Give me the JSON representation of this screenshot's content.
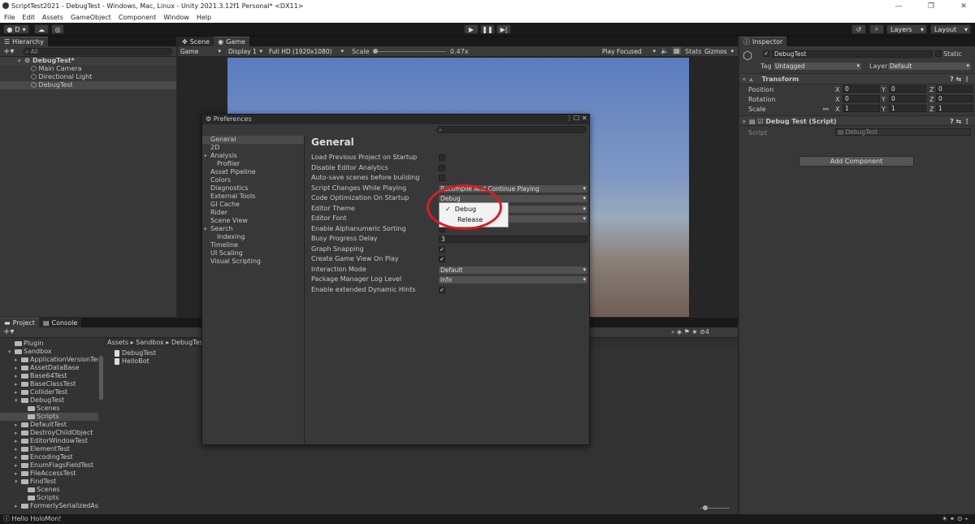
{
  "window": {
    "title": "ScriptTest2021 - DebugTest - Windows, Mac, Linux - Unity 2021.3.12f1 Personal* <DX11>",
    "controls": [
      "—",
      "❐",
      "✕"
    ]
  },
  "menu": [
    "File",
    "Edit",
    "Assets",
    "GameObject",
    "Component",
    "Window",
    "Help"
  ],
  "toolbar": {
    "account": "D",
    "layers": "Layers",
    "layout": "Layout"
  },
  "hierarchy": {
    "tab": "Hierarchy",
    "search_placeholder": "All",
    "scene": "DebugTest*",
    "items": [
      "Main Camera",
      "Directional Light",
      "DebugTest"
    ]
  },
  "game_view": {
    "tabs": [
      "Scene",
      "Game"
    ],
    "mode": "Game",
    "display": "Display 1",
    "resolution": "Full HD (1920x1080)",
    "scale_label": "Scale",
    "scale_value": "0.47x",
    "play_focused": "Play Focused",
    "stats": "Stats",
    "gizmos": "Gizmos"
  },
  "inspector": {
    "tab": "Inspector",
    "object_name": "DebugTest",
    "static_label": "Static",
    "tag_label": "Tag",
    "tag_value": "Untagged",
    "layer_label": "Layer",
    "layer_value": "Default",
    "transform": {
      "title": "Transform",
      "rows": [
        {
          "label": "Position",
          "x": "0",
          "y": "0",
          "z": "0"
        },
        {
          "label": "Rotation",
          "x": "0",
          "y": "0",
          "z": "0"
        },
        {
          "label": "Scale",
          "x": "1",
          "y": "1",
          "z": "1"
        }
      ]
    },
    "script_component": {
      "title": "Debug Test (Script)",
      "script_label": "Script",
      "script_value": "DebugTest"
    },
    "add_component": "Add Component"
  },
  "preferences": {
    "title": "Preferences",
    "heading": "General",
    "nav": [
      {
        "label": "General",
        "indent": 0,
        "selected": true
      },
      {
        "label": "2D",
        "indent": 0
      },
      {
        "label": "Analysis",
        "indent": 0,
        "fold": true
      },
      {
        "label": "Profiler",
        "indent": 2
      },
      {
        "label": "Asset Pipeline",
        "indent": 0
      },
      {
        "label": "Colors",
        "indent": 0
      },
      {
        "label": "Diagnostics",
        "indent": 0
      },
      {
        "label": "External Tools",
        "indent": 0
      },
      {
        "label": "GI Cache",
        "indent": 0
      },
      {
        "label": "Rider",
        "indent": 0
      },
      {
        "label": "Scene View",
        "indent": 0
      },
      {
        "label": "Search",
        "indent": 0,
        "fold": true
      },
      {
        "label": "Indexing",
        "indent": 2
      },
      {
        "label": "Timeline",
        "indent": 0
      },
      {
        "label": "UI Scaling",
        "indent": 0
      },
      {
        "label": "Visual Scripting",
        "indent": 0
      }
    ],
    "settings": [
      {
        "label": "Load Previous Project on Startup",
        "type": "check",
        "value": false
      },
      {
        "label": "Disable Editor Analytics",
        "type": "check",
        "value": false
      },
      {
        "label": "Auto-save scenes before building",
        "type": "check",
        "value": false
      },
      {
        "label": "Script Changes While Playing",
        "type": "dropdown",
        "value": "Recompile And Continue Playing"
      },
      {
        "label": "Code Optimization On Startup",
        "type": "dropdown",
        "value": "Debug"
      },
      {
        "label": "Editor Theme",
        "type": "dropdown",
        "value": ""
      },
      {
        "label": "Editor Font",
        "type": "dropdown",
        "value": ""
      },
      {
        "label": "Enable Alphanumeric Sorting",
        "type": "check",
        "value": false
      },
      {
        "label": "Busy Progress Delay",
        "type": "text",
        "value": "3"
      },
      {
        "label": "Graph Snapping",
        "type": "check",
        "value": true
      },
      {
        "label": "Create Game View On Play",
        "type": "check",
        "value": true
      },
      {
        "label": "Interaction Mode",
        "type": "dropdown",
        "value": "Default"
      },
      {
        "label": "Package Manager Log Level",
        "type": "dropdown",
        "value": "Info"
      },
      {
        "label": "Enable extended Dynamic Hints",
        "type": "check",
        "value": true
      }
    ],
    "popup_options": [
      {
        "label": "Debug",
        "checked": true
      },
      {
        "label": "Release",
        "checked": false
      }
    ],
    "highlight_color": "#d81e22"
  },
  "project": {
    "tabs": [
      "Project",
      "Console"
    ],
    "badge": "4",
    "breadcrumb": [
      "Assets",
      "Sandbox",
      "DebugTest"
    ],
    "tree": [
      {
        "label": "Plugin",
        "indent": 1,
        "fold": false
      },
      {
        "label": "Sandbox",
        "indent": 1,
        "fold": true,
        "open": true
      },
      {
        "label": "ApplicationVersionTest",
        "indent": 2,
        "fold": true
      },
      {
        "label": "AssetDataBase",
        "indent": 2,
        "fold": true
      },
      {
        "label": "Base64Test",
        "indent": 2,
        "fold": true
      },
      {
        "label": "BaseClassTest",
        "indent": 2,
        "fold": true
      },
      {
        "label": "ColliderTest",
        "indent": 2,
        "fold": true
      },
      {
        "label": "DebugTest",
        "indent": 2,
        "fold": true,
        "open": true
      },
      {
        "label": "Scenes",
        "indent": 3
      },
      {
        "label": "Scripts",
        "indent": 3,
        "selected": true
      },
      {
        "label": "DefaultTest",
        "indent": 2,
        "fold": true
      },
      {
        "label": "DestroyChildObject",
        "indent": 2,
        "fold": true
      },
      {
        "label": "EditorWindowTest",
        "indent": 2,
        "fold": true
      },
      {
        "label": "ElementTest",
        "indent": 2,
        "fold": true
      },
      {
        "label": "EncodingTest",
        "indent": 2,
        "fold": true
      },
      {
        "label": "EnumFlagsFieldTest",
        "indent": 2,
        "fold": true
      },
      {
        "label": "FileAccessTest",
        "indent": 2,
        "fold": true
      },
      {
        "label": "FindTest",
        "indent": 2,
        "fold": true,
        "open": true
      },
      {
        "label": "Scenes",
        "indent": 3
      },
      {
        "label": "Scripts",
        "indent": 3
      },
      {
        "label": "FormerlySerializedAsTe",
        "indent": 2,
        "fold": true
      }
    ],
    "files": [
      "DebugTest",
      "HelloBot"
    ]
  },
  "status": {
    "message": "Hello HoloMon!"
  },
  "colors": {
    "sky_top": "#5b7bbf",
    "sky_bottom": "#9aa9bc",
    "ground": "#6f5f55",
    "accent": "#d81e22"
  }
}
